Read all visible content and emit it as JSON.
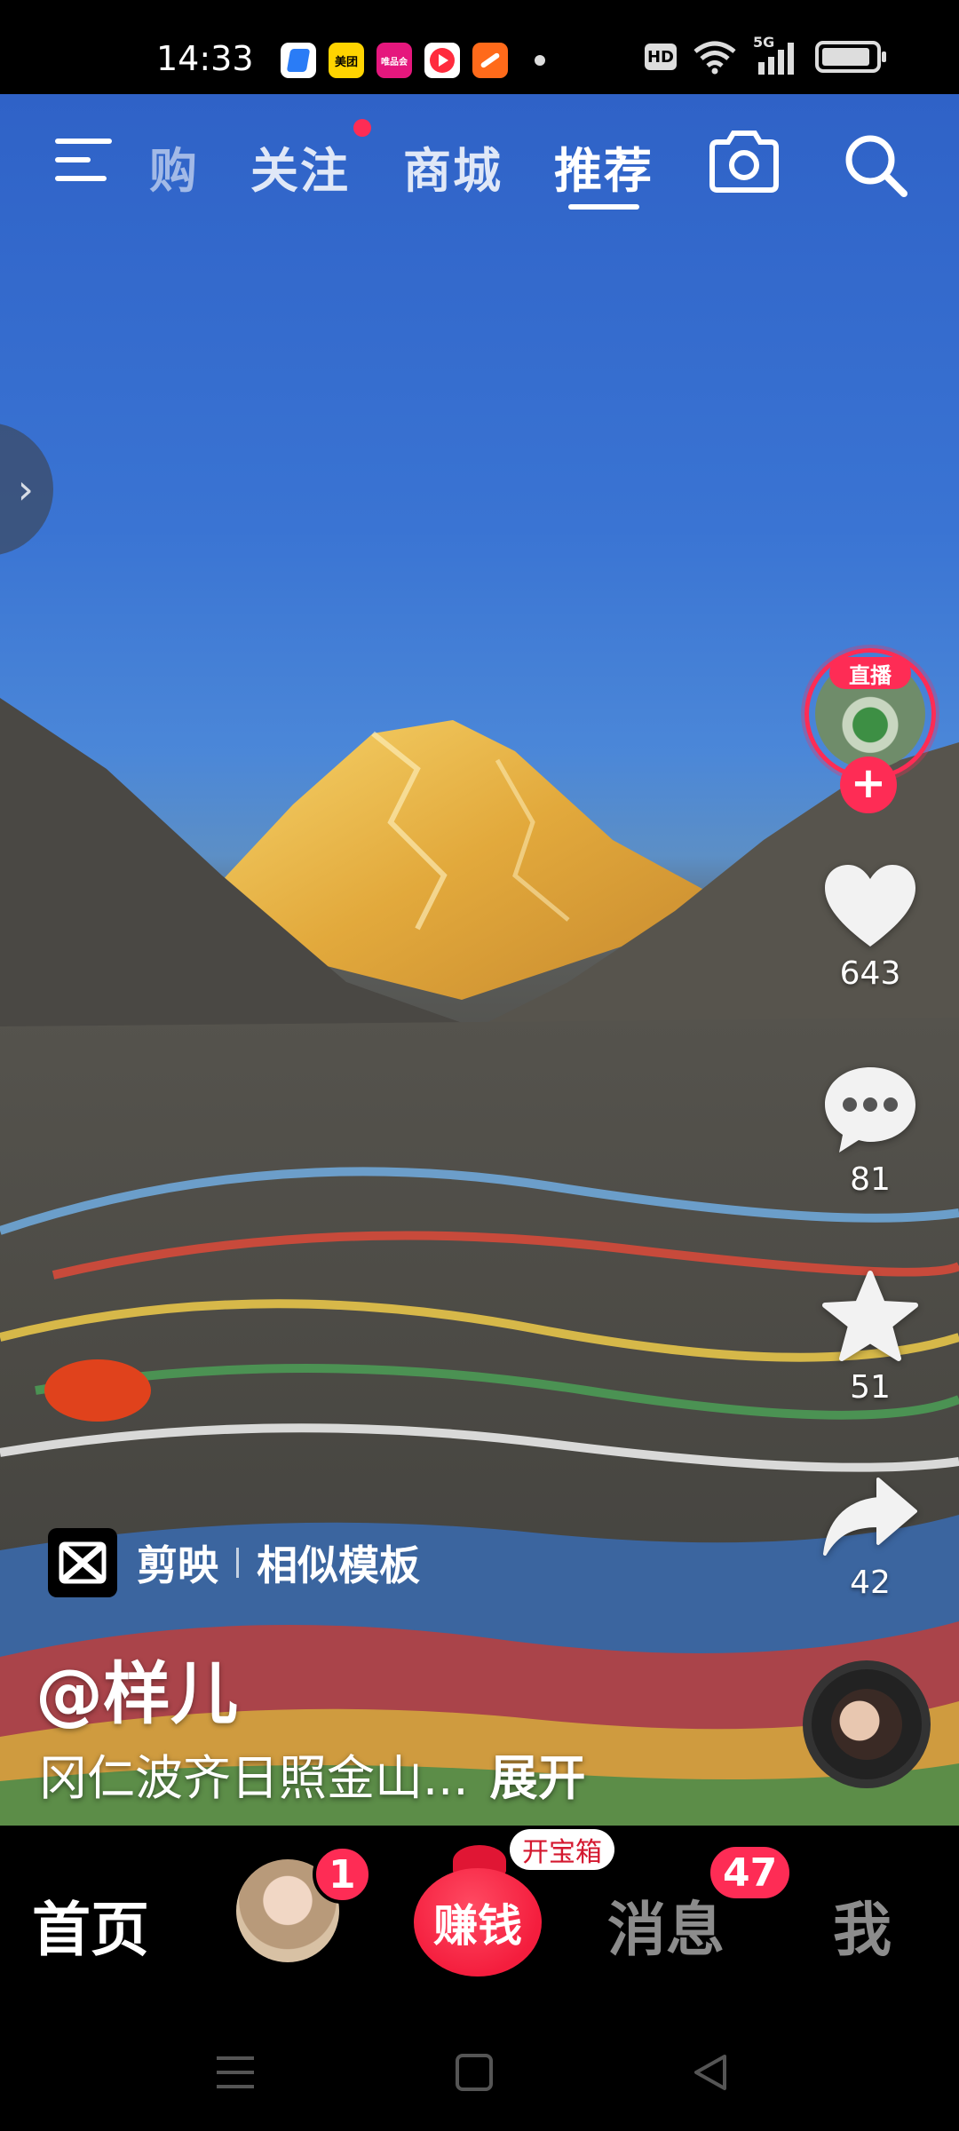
{
  "status_bar": {
    "time": "14:33",
    "apps": [
      {
        "name": "blue-app-icon",
        "label": "",
        "bg": "#ffffff",
        "fg": "#2a7cf6"
      },
      {
        "name": "meituan-icon",
        "label": "美团",
        "bg": "#ffd400",
        "fg": "#000000"
      },
      {
        "name": "vip-shop-icon",
        "label": "唯品会",
        "bg": "#e5177d",
        "fg": "#ffffff"
      },
      {
        "name": "video-app-icon",
        "label": "▶",
        "bg": "#ffffff",
        "fg": "#ff2b3d"
      },
      {
        "name": "orange-app-icon",
        "label": "",
        "bg": "#ff6a1a",
        "fg": "#ffffff"
      }
    ],
    "hd": "HD",
    "network": "5G"
  },
  "top_nav": {
    "tabs": [
      {
        "label": "购",
        "state": "faded"
      },
      {
        "label": "关注",
        "state": "normal"
      },
      {
        "label": "商城",
        "state": "normal"
      },
      {
        "label": "推荐",
        "state": "active"
      }
    ]
  },
  "side_handle": {
    "icon": "chevron-right-icon"
  },
  "creator": {
    "live_label": "直播",
    "follow_symbol": "+"
  },
  "rail": {
    "likes": "643",
    "comments": "81",
    "favorites": "51",
    "shares": "42"
  },
  "caption": {
    "app_name": "剪映",
    "template_label": "相似模板",
    "author": "@样儿",
    "description": "冈仁波齐日照金山...",
    "expand_label": "展开"
  },
  "tabbar": {
    "home": "首页",
    "friend_badge": "1",
    "earn": "赚钱",
    "treasure": "开宝箱",
    "messages": "消息",
    "messages_badge": "47",
    "me": "我"
  },
  "colors": {
    "accent": "#fe2c55",
    "sky": "#2f62c7",
    "peak": "#e8b84a"
  }
}
